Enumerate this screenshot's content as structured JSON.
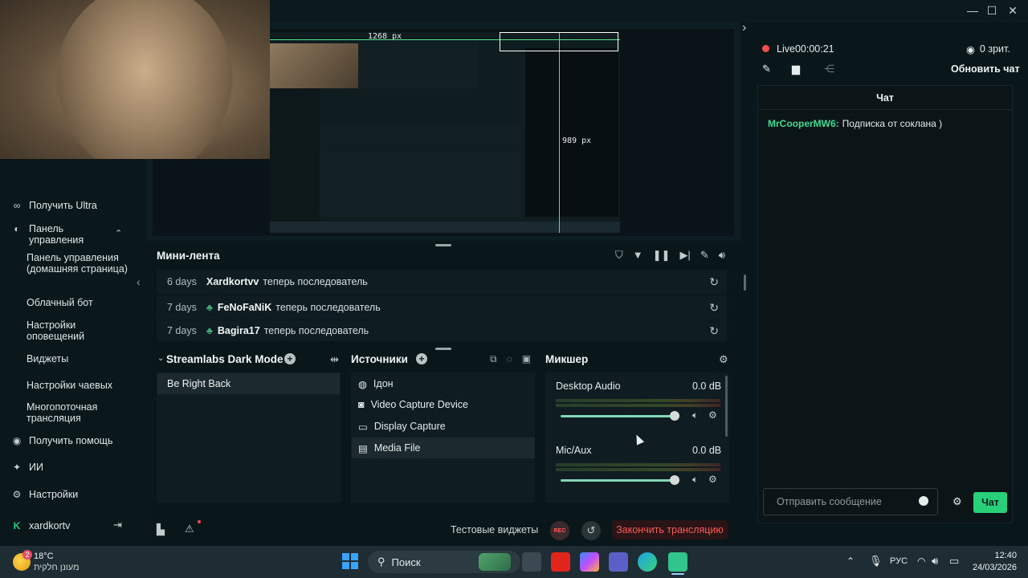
{
  "window": {
    "minimize": "—",
    "maximize": "☐",
    "close": "✕",
    "collapse_right": "›"
  },
  "preview": {
    "width_label": "1268 px",
    "height_label": "989 px"
  },
  "nav": {
    "items": [
      {
        "label": "Получить Ultra",
        "icon": "ultra-icon"
      },
      {
        "label": "Панель управления",
        "icon": "dashboard-icon"
      }
    ],
    "sub_items": [
      "Панель управления (домашняя страница)",
      "Облачный бот",
      "Настройки оповещений",
      "Виджеты",
      "Настройки чаевых",
      "Многопоточная трансляция"
    ],
    "bottom_items": [
      {
        "label": "Получить помощь",
        "icon": "help-icon"
      },
      {
        "label": "ИИ",
        "icon": "ai-icon"
      },
      {
        "label": "Настройки",
        "icon": "gear-icon"
      }
    ],
    "user": "xardkortv"
  },
  "minifeed": {
    "title": "Мини-лента",
    "rows": [
      {
        "days": "6 days",
        "name": "Xardkortvv",
        "text": "теперь последователь"
      },
      {
        "days": "7 days",
        "name": "FeNoFaNiK",
        "text": "теперь последователь"
      },
      {
        "days": "7 days",
        "name": "Bagira17",
        "text": "теперь последователь"
      }
    ]
  },
  "scenes": {
    "title": "Streamlabs Dark Mode",
    "items": [
      "Be Right Back"
    ]
  },
  "sources": {
    "title": "Источники",
    "items": [
      "Ідон",
      "Video Capture Device",
      "Display Capture",
      "Media File"
    ]
  },
  "mixer": {
    "title": "Микшер",
    "channels": [
      {
        "name": "Desktop Audio",
        "level": "0.0 dB",
        "volume": 1.0
      },
      {
        "name": "Mic/Aux",
        "level": "0.0 dB",
        "volume": 1.0
      }
    ]
  },
  "footer": {
    "test_widgets": "Тестовые виджеты",
    "end_stream": "Закончить трансляцию"
  },
  "chat": {
    "live": "Live",
    "timer": "00:00:21",
    "viewers": "0 зрит.",
    "refresh": "Обновить чат",
    "header": "Чат",
    "messages": [
      {
        "user": "MrCooperMW6:",
        "text": "Подписка от соклана )"
      }
    ],
    "input_placeholder": "Отправить сообщение",
    "send": "Чат"
  },
  "taskbar": {
    "weather_temp": "18°C",
    "weather_desc": "מעונן חלקית",
    "weather_badge": "2",
    "search": "Поиск",
    "lang": "РУС",
    "time": "12:40",
    "date": "24/03/2026"
  },
  "colors": {
    "accent": "#28d07a",
    "live": "#ff4d4d",
    "end_stream": "#ff5b57",
    "slider": "#7fd7b6"
  }
}
